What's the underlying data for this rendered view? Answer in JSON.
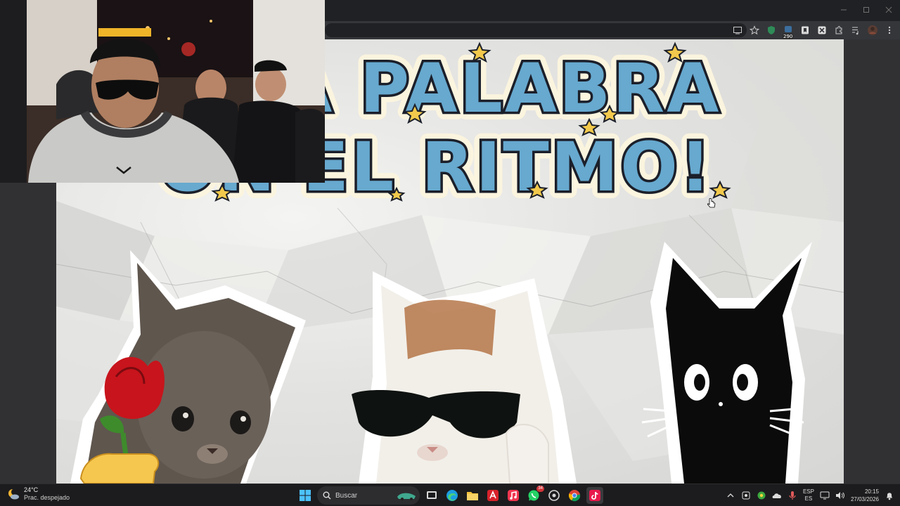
{
  "window_controls": {
    "minimize_icon": "minimize-icon",
    "maximize_icon": "maximize-icon",
    "close_icon": "close-icon"
  },
  "toolbar": {
    "icons": [
      "cast-icon",
      "star-icon",
      "ext-shield-icon",
      "ext-counter-icon",
      "bookmark-icon",
      "ext-puzzle-icon",
      "puzzle-icon",
      "media-icon",
      "profile-avatar",
      "more-menu-icon"
    ],
    "ext_badge": "290"
  },
  "video": {
    "title_line1": "A PALABRA",
    "title_line2": "ON EL RITMO!",
    "colors": {
      "title_fill": "#67a9cf",
      "title_outline": "#1b1f2a",
      "title_glow": "#fbf4de",
      "stars": "#f2c94c"
    }
  },
  "taskbar": {
    "weather": {
      "temperature": "24°C",
      "condition": "Prac. despejado"
    },
    "search_placeholder": "Buscar",
    "apps": [
      "windows-start",
      "search",
      "task-view",
      "edge",
      "file-explorer",
      "adobe-app",
      "itunes",
      "whatsapp",
      "app-circle",
      "chrome",
      "tiktok"
    ],
    "whatsapp_badge": "34",
    "language_top": "ESP",
    "language_bottom": "ES",
    "time": "20:15",
    "date": "27/03/2026"
  }
}
